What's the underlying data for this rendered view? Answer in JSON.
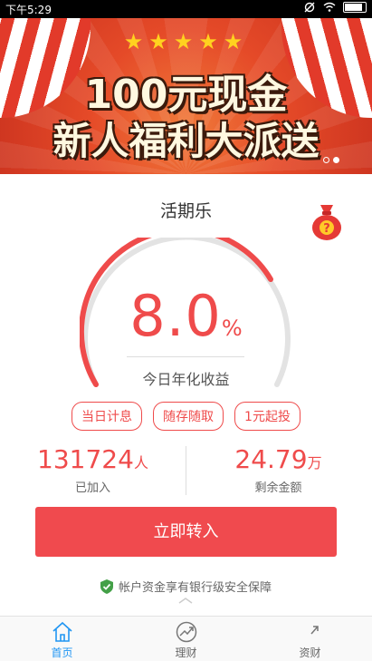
{
  "status_bar": {
    "time": "下午5:29"
  },
  "banner": {
    "line1": "100元现金",
    "line2": "新人福利大派送",
    "stars": "★★★★★",
    "slide_count": 2,
    "active_slide": 2
  },
  "product": {
    "title": "活期乐",
    "rate_value": "8.0",
    "rate_unit": "%",
    "rate_label": "今日年化收益",
    "gauge_fill_fraction": 0.35
  },
  "tags": [
    "当日计息",
    "随存随取",
    "1元起投"
  ],
  "stats": {
    "joined_value": "131724",
    "joined_unit": "人",
    "joined_label": "已加入",
    "remaining_value": "24.79",
    "remaining_unit": "万",
    "remaining_label": "剩余金额"
  },
  "cta": {
    "label": "立即转入"
  },
  "security_note": "帐户资金享有银行级安全保障",
  "tabbar": {
    "items": [
      {
        "label": "首页",
        "icon": "home-icon",
        "active": true
      },
      {
        "label": "理财",
        "icon": "chart-trend-icon",
        "active": false
      },
      {
        "label": "资财",
        "icon": "asset-arrow-icon",
        "active": false
      }
    ]
  },
  "colors": {
    "accent": "#ef4b4b",
    "button": "#f04a4e",
    "tab_active": "#2196f3"
  }
}
